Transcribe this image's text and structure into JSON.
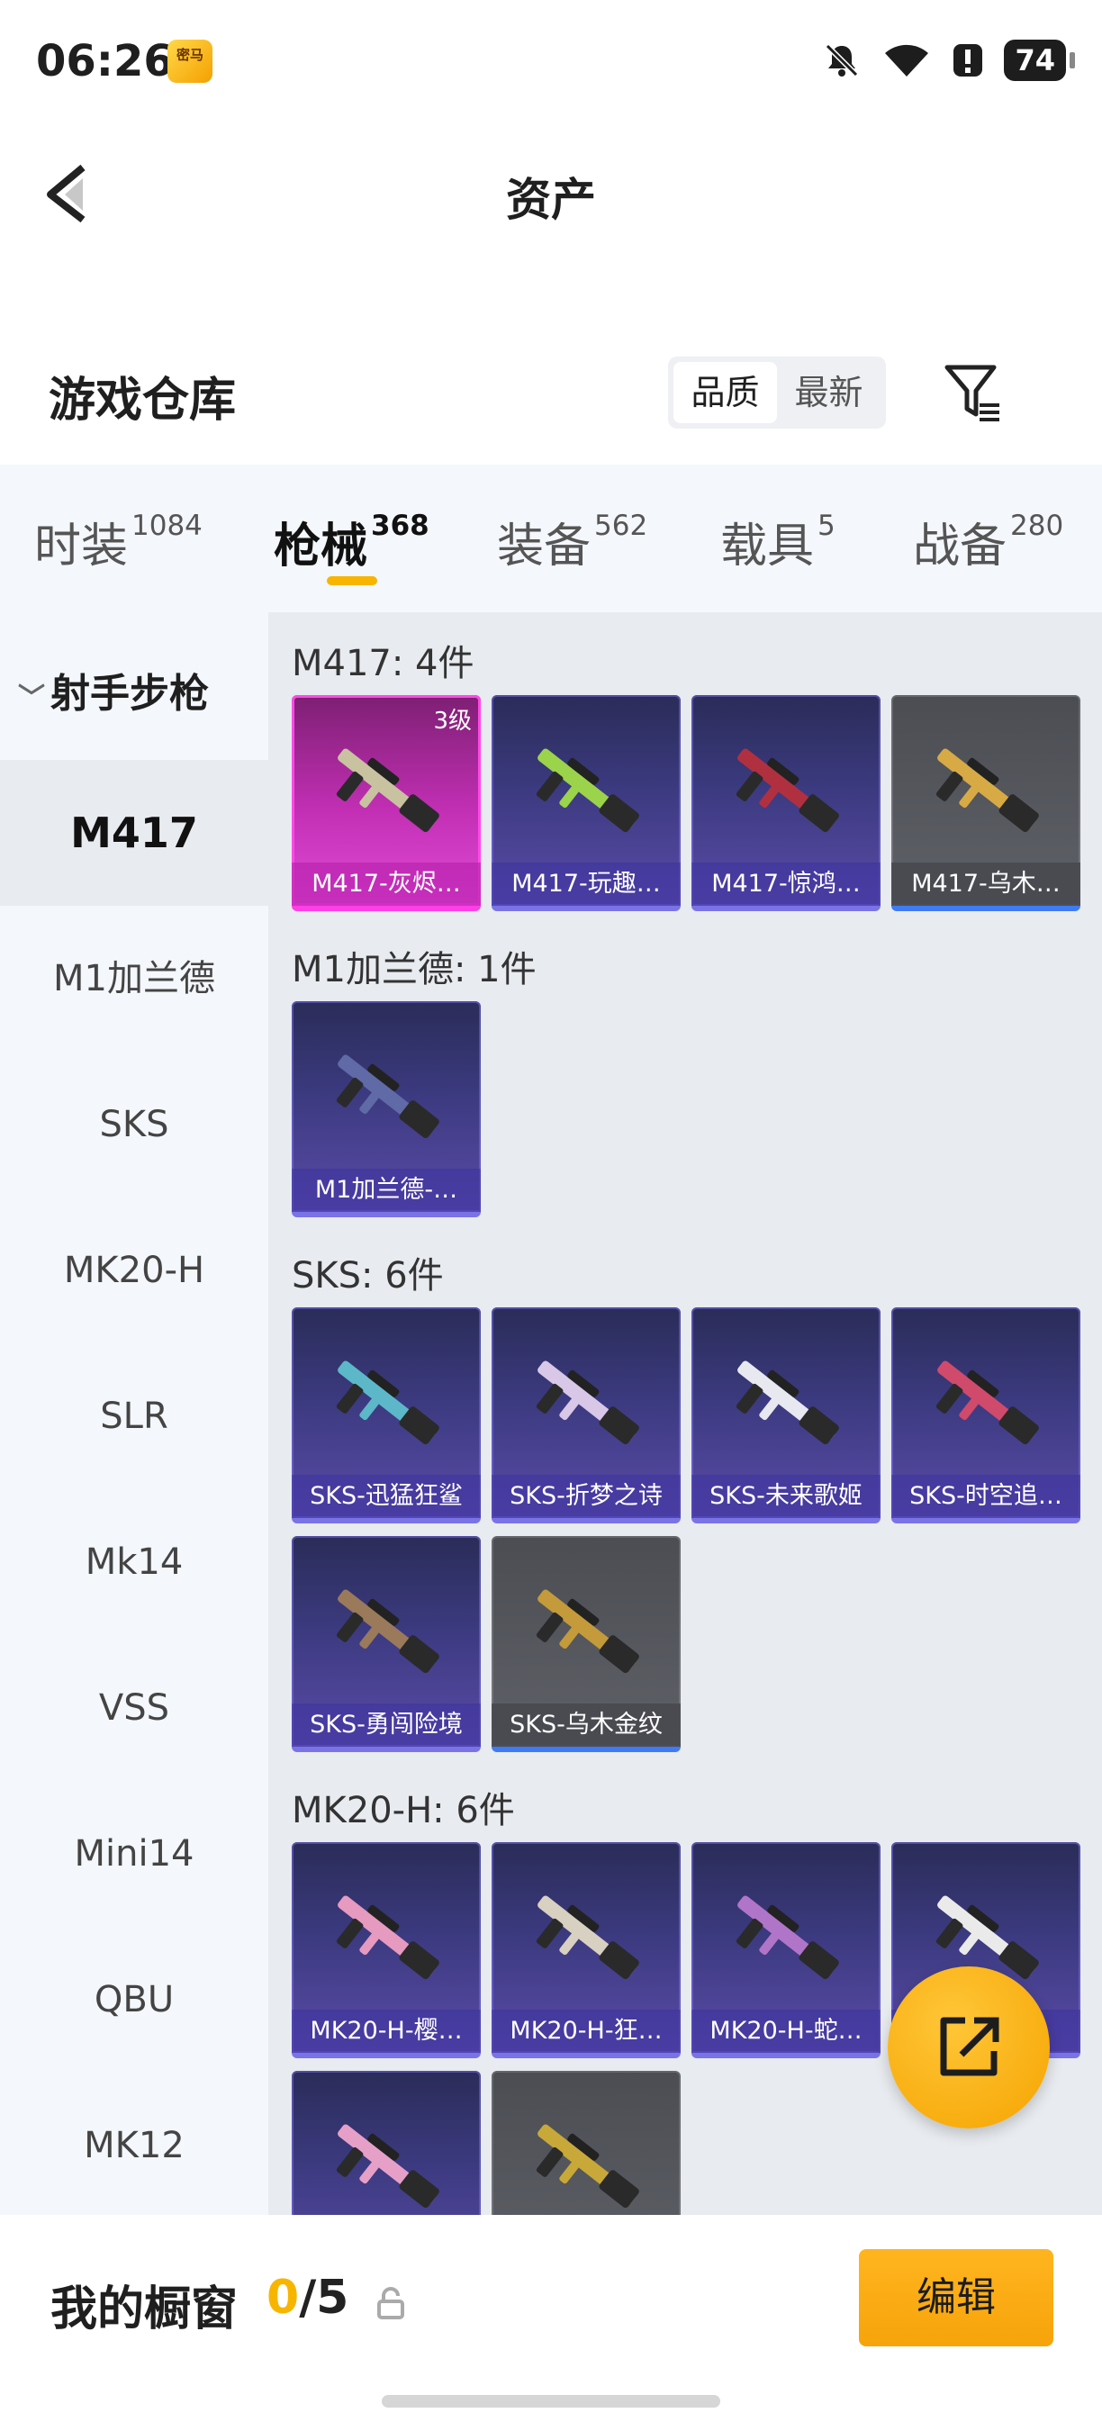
{
  "status_bar": {
    "time": "06:26",
    "app_badge": "密马",
    "battery": "74"
  },
  "header": {
    "title": "资产"
  },
  "warehouse": {
    "title": "游戏仓库",
    "sort": [
      "品质",
      "最新"
    ],
    "sort_active": "品质"
  },
  "tabs": [
    {
      "label": "时装",
      "count": "1084"
    },
    {
      "label": "枪械",
      "count": "368",
      "active": true
    },
    {
      "label": "装备",
      "count": "562"
    },
    {
      "label": "载具",
      "count": "5"
    },
    {
      "label": "战备",
      "count": "280"
    }
  ],
  "sidebar": {
    "header": "射手步枪",
    "items": [
      "M417",
      "M1加兰德",
      "SKS",
      "MK20-H",
      "SLR",
      "Mk14",
      "VSS",
      "Mini14",
      "QBU",
      "MK12"
    ],
    "active": "M417"
  },
  "groups": [
    {
      "title": "M417: 4件",
      "items": [
        {
          "label": "M417-灰烬…",
          "rarity": "pink",
          "level": "3级"
        },
        {
          "label": "M417-玩趣…",
          "rarity": "purple"
        },
        {
          "label": "M417-惊鸿…",
          "rarity": "purple"
        },
        {
          "label": "M417-乌木…",
          "rarity": "gold"
        }
      ]
    },
    {
      "title": "M1加兰德: 1件",
      "items": [
        {
          "label": "M1加兰德-…",
          "rarity": "purple"
        }
      ]
    },
    {
      "title": "SKS: 6件",
      "items": [
        {
          "label": "SKS-迅猛狂鲨",
          "rarity": "purple"
        },
        {
          "label": "SKS-折梦之诗",
          "rarity": "purple"
        },
        {
          "label": "SKS-未来歌姬",
          "rarity": "purple"
        },
        {
          "label": "SKS-时空追…",
          "rarity": "purple"
        },
        {
          "label": "SKS-勇闯险境",
          "rarity": "purple"
        },
        {
          "label": "SKS-乌木金纹",
          "rarity": "gold"
        }
      ]
    },
    {
      "title": "MK20-H: 6件",
      "items": [
        {
          "label": "MK20-H-樱…",
          "rarity": "purple"
        },
        {
          "label": "MK20-H-狂…",
          "rarity": "purple"
        },
        {
          "label": "MK20-H-蛇…",
          "rarity": "purple"
        },
        {
          "label": "",
          "rarity": "purple"
        },
        {
          "label": "",
          "rarity": "purple"
        },
        {
          "label": "",
          "rarity": "gold"
        }
      ]
    }
  ],
  "showcase": {
    "label": "我的橱窗",
    "current": "0",
    "total": "/5",
    "edit": "编辑"
  },
  "colors": {
    "accent": "#f7b500",
    "purple": "#3c3a80",
    "pink": "#c22fb4",
    "gold": "#5f6168"
  },
  "icons": {
    "back": "chevron-left-icon",
    "filter": "filter-icon",
    "share": "share-out-icon",
    "lock": "lock-icon"
  }
}
